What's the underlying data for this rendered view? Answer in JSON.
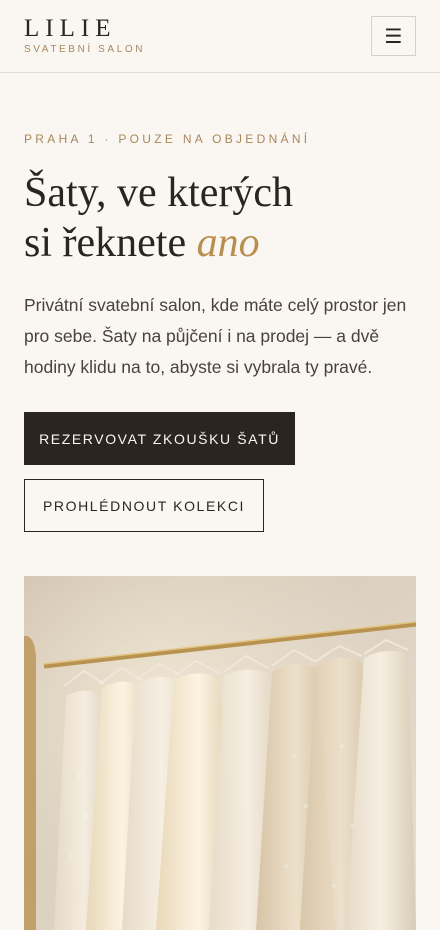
{
  "header": {
    "brand_name": "LILIE",
    "brand_tagline": "SVATEBNÍ SALON",
    "menu_icon": "hamburger-menu-icon",
    "menu_glyph": "☰"
  },
  "hero": {
    "eyebrow": "PRAHA 1 · POUZE NA OBJEDNÁNÍ",
    "headline_line1": "Šaty, ve kterých",
    "headline_line2": "si řeknete",
    "headline_accent": "ano",
    "lead": "Privátní svatební salon, kde máte celý prostor jen pro sebe. Šaty na půjčení i na prodej — a dvě hodiny klidu na to, abyste si vybrala ty pravé.",
    "primary_cta": "REZERVOVAT ZKOUŠKU ŠATŮ",
    "secondary_cta": "PROHLÉDNOUT KOLEKCI"
  },
  "image": {
    "subject": "wedding-dresses-on-rack"
  },
  "colors": {
    "background": "#faf7f3",
    "text": "#2b2522",
    "accent": "#b88f4f",
    "muted_gold": "#a8875a"
  }
}
